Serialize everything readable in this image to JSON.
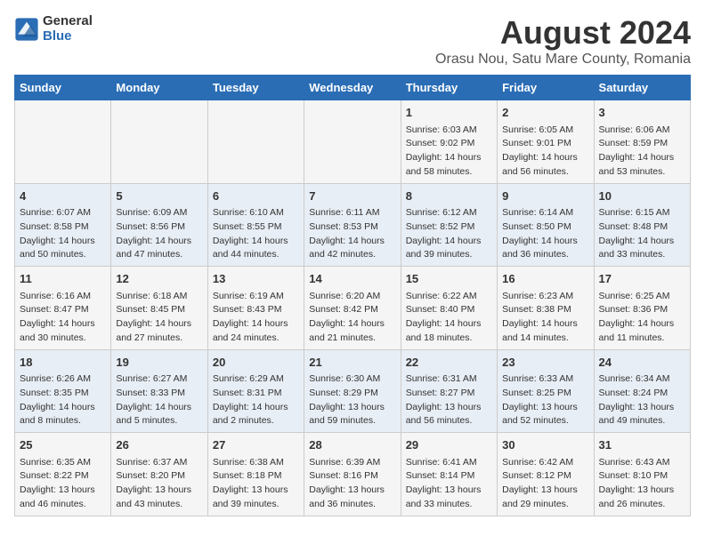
{
  "logo": {
    "general": "General",
    "blue": "Blue"
  },
  "title": "August 2024",
  "subtitle": "Orasu Nou, Satu Mare County, Romania",
  "headers": [
    "Sunday",
    "Monday",
    "Tuesday",
    "Wednesday",
    "Thursday",
    "Friday",
    "Saturday"
  ],
  "weeks": [
    [
      {
        "day": "",
        "content": ""
      },
      {
        "day": "",
        "content": ""
      },
      {
        "day": "",
        "content": ""
      },
      {
        "day": "",
        "content": ""
      },
      {
        "day": "1",
        "content": "Sunrise: 6:03 AM\nSunset: 9:02 PM\nDaylight: 14 hours\nand 58 minutes."
      },
      {
        "day": "2",
        "content": "Sunrise: 6:05 AM\nSunset: 9:01 PM\nDaylight: 14 hours\nand 56 minutes."
      },
      {
        "day": "3",
        "content": "Sunrise: 6:06 AM\nSunset: 8:59 PM\nDaylight: 14 hours\nand 53 minutes."
      }
    ],
    [
      {
        "day": "4",
        "content": "Sunrise: 6:07 AM\nSunset: 8:58 PM\nDaylight: 14 hours\nand 50 minutes."
      },
      {
        "day": "5",
        "content": "Sunrise: 6:09 AM\nSunset: 8:56 PM\nDaylight: 14 hours\nand 47 minutes."
      },
      {
        "day": "6",
        "content": "Sunrise: 6:10 AM\nSunset: 8:55 PM\nDaylight: 14 hours\nand 44 minutes."
      },
      {
        "day": "7",
        "content": "Sunrise: 6:11 AM\nSunset: 8:53 PM\nDaylight: 14 hours\nand 42 minutes."
      },
      {
        "day": "8",
        "content": "Sunrise: 6:12 AM\nSunset: 8:52 PM\nDaylight: 14 hours\nand 39 minutes."
      },
      {
        "day": "9",
        "content": "Sunrise: 6:14 AM\nSunset: 8:50 PM\nDaylight: 14 hours\nand 36 minutes."
      },
      {
        "day": "10",
        "content": "Sunrise: 6:15 AM\nSunset: 8:48 PM\nDaylight: 14 hours\nand 33 minutes."
      }
    ],
    [
      {
        "day": "11",
        "content": "Sunrise: 6:16 AM\nSunset: 8:47 PM\nDaylight: 14 hours\nand 30 minutes."
      },
      {
        "day": "12",
        "content": "Sunrise: 6:18 AM\nSunset: 8:45 PM\nDaylight: 14 hours\nand 27 minutes."
      },
      {
        "day": "13",
        "content": "Sunrise: 6:19 AM\nSunset: 8:43 PM\nDaylight: 14 hours\nand 24 minutes."
      },
      {
        "day": "14",
        "content": "Sunrise: 6:20 AM\nSunset: 8:42 PM\nDaylight: 14 hours\nand 21 minutes."
      },
      {
        "day": "15",
        "content": "Sunrise: 6:22 AM\nSunset: 8:40 PM\nDaylight: 14 hours\nand 18 minutes."
      },
      {
        "day": "16",
        "content": "Sunrise: 6:23 AM\nSunset: 8:38 PM\nDaylight: 14 hours\nand 14 minutes."
      },
      {
        "day": "17",
        "content": "Sunrise: 6:25 AM\nSunset: 8:36 PM\nDaylight: 14 hours\nand 11 minutes."
      }
    ],
    [
      {
        "day": "18",
        "content": "Sunrise: 6:26 AM\nSunset: 8:35 PM\nDaylight: 14 hours\nand 8 minutes."
      },
      {
        "day": "19",
        "content": "Sunrise: 6:27 AM\nSunset: 8:33 PM\nDaylight: 14 hours\nand 5 minutes."
      },
      {
        "day": "20",
        "content": "Sunrise: 6:29 AM\nSunset: 8:31 PM\nDaylight: 14 hours\nand 2 minutes."
      },
      {
        "day": "21",
        "content": "Sunrise: 6:30 AM\nSunset: 8:29 PM\nDaylight: 13 hours\nand 59 minutes."
      },
      {
        "day": "22",
        "content": "Sunrise: 6:31 AM\nSunset: 8:27 PM\nDaylight: 13 hours\nand 56 minutes."
      },
      {
        "day": "23",
        "content": "Sunrise: 6:33 AM\nSunset: 8:25 PM\nDaylight: 13 hours\nand 52 minutes."
      },
      {
        "day": "24",
        "content": "Sunrise: 6:34 AM\nSunset: 8:24 PM\nDaylight: 13 hours\nand 49 minutes."
      }
    ],
    [
      {
        "day": "25",
        "content": "Sunrise: 6:35 AM\nSunset: 8:22 PM\nDaylight: 13 hours\nand 46 minutes."
      },
      {
        "day": "26",
        "content": "Sunrise: 6:37 AM\nSunset: 8:20 PM\nDaylight: 13 hours\nand 43 minutes."
      },
      {
        "day": "27",
        "content": "Sunrise: 6:38 AM\nSunset: 8:18 PM\nDaylight: 13 hours\nand 39 minutes."
      },
      {
        "day": "28",
        "content": "Sunrise: 6:39 AM\nSunset: 8:16 PM\nDaylight: 13 hours\nand 36 minutes."
      },
      {
        "day": "29",
        "content": "Sunrise: 6:41 AM\nSunset: 8:14 PM\nDaylight: 13 hours\nand 33 minutes."
      },
      {
        "day": "30",
        "content": "Sunrise: 6:42 AM\nSunset: 8:12 PM\nDaylight: 13 hours\nand 29 minutes."
      },
      {
        "day": "31",
        "content": "Sunrise: 6:43 AM\nSunset: 8:10 PM\nDaylight: 13 hours\nand 26 minutes."
      }
    ]
  ]
}
